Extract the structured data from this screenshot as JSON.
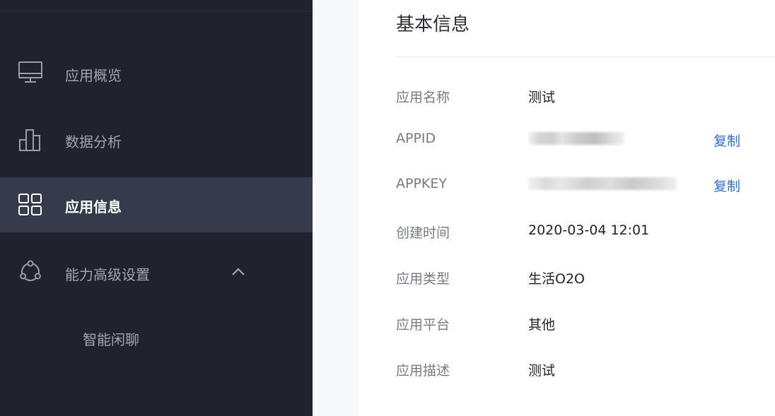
{
  "sidebar": {
    "items": [
      {
        "label": "应用概览",
        "icon": "monitor-icon"
      },
      {
        "label": "数据分析",
        "icon": "bar-chart-icon"
      },
      {
        "label": "应用信息",
        "icon": "grid-icon",
        "active": true
      },
      {
        "label": "能力高级设置",
        "icon": "network-icon",
        "expanded": true
      }
    ],
    "subitems": [
      {
        "label": "智能闲聊"
      }
    ]
  },
  "main": {
    "title": "基本信息",
    "copy_label": "复制",
    "rows": [
      {
        "label": "应用名称",
        "value": "测试"
      },
      {
        "label": "APPID",
        "value": ""
      },
      {
        "label": "APPKEY",
        "value": ""
      },
      {
        "label": "创建时间",
        "value": "2020-03-04 12:01"
      },
      {
        "label": "应用类型",
        "value": "生活O2O"
      },
      {
        "label": "应用平台",
        "value": "其他"
      },
      {
        "label": "应用描述",
        "value": "测试"
      }
    ]
  },
  "colors": {
    "sidebar_bg": "#20232d",
    "active_bg": "#343c4b",
    "link": "#2f6fd1"
  }
}
